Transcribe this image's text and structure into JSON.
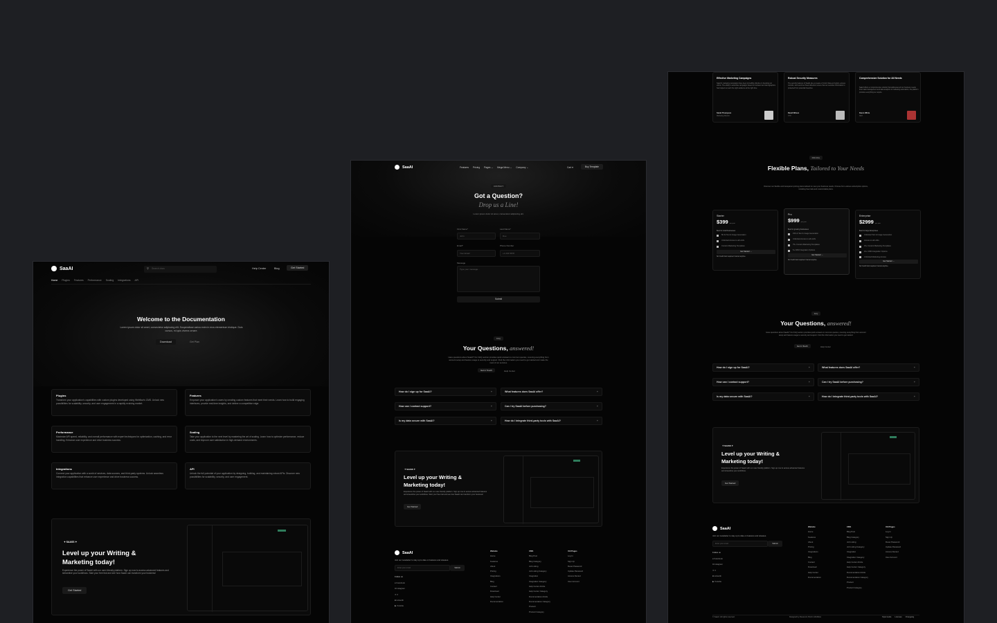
{
  "doc": {
    "brand": "SaaAI",
    "search_placeholder": "Search docs",
    "nav": {
      "help": "Help Center",
      "blog": "Blog",
      "cta": "Get Started"
    },
    "tabs": [
      "Home",
      "Plugins",
      "Features",
      "Performance",
      "Scaling",
      "Integrations",
      "API"
    ],
    "hero": {
      "title": "Welcome to the Documentation",
      "desc": "Lorem ipsum dolor sit amet, consectetur adipiscing elit. Suspendisse varius enim in eros elementum tristique. Duis cursus, mi quis viverra ornare.",
      "btn1": "Download",
      "btn2": "Get Plan"
    },
    "cards": [
      {
        "title": "Plugins",
        "desc": "Transform your application's capabilities with custom plugins developed using Webflow's CMS. Unlock new possibilities for scalability, security, and user engagement in a rapidly evolving market."
      },
      {
        "title": "Features",
        "desc": "Empower your application's users by creating custom features that meet their needs. Learn how to build engaging interfaces, provide real-time insights, and deliver a competitive edge."
      },
      {
        "title": "Performance",
        "desc": "Maximize API speed, reliability, and overall performance with expert techniques for optimization, caching, and error handling. Enhance user experience and drive business success."
      },
      {
        "title": "Scaling",
        "desc": "Take your application to the next level by mastering the art of scaling. Learn how to optimize performance, reduce costs, and improve user satisfaction in high-demand environments."
      },
      {
        "title": "Integrations",
        "desc": "Connect your application with a world of services, data sources, and third-party systems. Unlock seamless integration capabilities that enhance user experience and drive business success."
      },
      {
        "title": "API",
        "desc": "Unlock the full potential of your application by designing, building, and maintaining robust APIs. Discover new possibilities for scalability, security, and user engagement."
      }
    ],
    "cta": {
      "badge": "SAASS",
      "title1": "Level up your Writing &",
      "title2": "Marketing today!",
      "desc": "Experience the power of SaaAI with our user-friendly platform. Sign up now to access advanced features and streamline your workflows. Start your free trial and see how SaaAI can transform your business!",
      "btn": "Get Started"
    }
  },
  "contact": {
    "brand": "SaaAI",
    "nav": [
      "Features",
      "Pricing",
      "Pages",
      "Mega Menu",
      "Company"
    ],
    "cart": "Cart",
    "buy": "Buy Template",
    "badge": "CONTACT",
    "title": "Got a Question?",
    "subtitle": "Drop us a Line!",
    "desc": "Lorem ipsum dolor sit amet, consectetur adipiscing elit.",
    "form": {
      "first_label": "First Name*",
      "first_ph": "John",
      "last_label": "Last Name*",
      "last_ph": "Doe",
      "email_label": "Email*",
      "email_ph": "Your Email",
      "phone_label": "Phone Number",
      "phone_ph": "+1 234 5678",
      "msg_label": "Message",
      "msg_ph": "Type your message...",
      "submit": "Submit"
    },
    "faq_badge": "FAQ",
    "faq_title": "Your Questions,",
    "faq_title_em": "answered!",
    "faq_desc": "Have questions about SaaAI? Our FAQ section provides quick answers to common queries, covering everything from account setup and feature usage to security and support. Find the information you need to get started and make the most of our services.",
    "faq_btn1": "Get in Touch",
    "faq_btn2": "Help Center",
    "faqs": [
      "How do I sign up for SaaAI?",
      "What features does SaaAI offer?",
      "How can I contact support?",
      "Can I try SaaAI before purchasing?",
      "Is my data secure with SaaAI?",
      "How do I integrate third-party tools with SaaAI?"
    ],
    "cta": {
      "badge": "SAASS",
      "title1": "Level up your Writing &",
      "title2": "Marketing today!",
      "desc": "Experience the power of SaaAI with our user-friendly platform. Sign up now to access advanced features and streamline your workflows. Start your free trial and see how SaaAI can transform your business!",
      "btn": "Get Started"
    },
    "footer": {
      "newsletter": "Join our newsletter to stay up to date on features and releases.",
      "email_ph": "Enter your email",
      "subscribe": "Submit",
      "follow": "Follow us",
      "socials": [
        "Facebook",
        "Instagram",
        "X",
        "LinkedIn",
        "Youtube"
      ],
      "col1": {
        "head": "Website",
        "items": [
          "Home",
          "Features",
          "About",
          "Pricing",
          "Integrations",
          "Blog",
          "Contact",
          "Download",
          "Help Center",
          "Documentation"
        ]
      },
      "col2": {
        "head": "CMS",
        "items": [
          "Blog Post",
          "Blog Category",
          "Job Listing",
          "Job Listing Category",
          "Integration",
          "Integration Category",
          "Help Center Article",
          "Help Center Category",
          "Documentation Article",
          "Documentation Category",
          "Product",
          "Product Category"
        ]
      },
      "col3": {
        "head": "Util Pages",
        "items": [
          "Log In",
          "Sign Up",
          "Reset Password",
          "Update Password",
          "Access Denied",
          "User Account"
        ]
      }
    }
  },
  "pricing": {
    "testimonials": [
      {
        "title": "Effective Marketing Campaigns",
        "text": "SaaAI's marketing campaigns have been incredibly effective in boosting our efforts. The ability to automate campaigns based on behavior and demographics has helped us reach the right audience at the right time.",
        "name": "Sarah Thompson",
        "role": "Marketing Director"
      },
      {
        "title": "Robust Security Measures",
        "text": "The security features of SaaAI give us peace of mind. Data encryption, access controls, and real-time threat detection ensure that our sensitive information is protected from potential breaches.",
        "name": "David Wilson",
        "role": "CTO"
      },
      {
        "title": "Comprehensive Solution for All Needs",
        "text": "SaaAI offers a comprehensive solution that addresses all our business needs. From task management and data analytics to marketing automation, the platform provides everything we require.",
        "name": "Karen White",
        "role": "CEO"
      }
    ],
    "badge": "PRICING",
    "title": "Flexible Plans,",
    "title_em": "Tailored to Your Needs",
    "desc": "Discover our flexible and transparent pricing plans tailored to meet your business needs. Choose from various subscription options, including free trials and customizable plans.",
    "plans": [
      {
        "name": "Starter",
        "price": "$399",
        "per": "per year",
        "best": "Best for small businesses",
        "features": [
          "5K AI Text & Image Generation",
          "Unlimited Access to all LLMs",
          "Content Marketing Templates"
        ],
        "btn": "Get Started",
        "note": "No Credit Card required. Cancel anytime."
      },
      {
        "name": "Pro",
        "price": "$999",
        "per": "per year",
        "best": "Best for growing businesses",
        "features": [
          "15K AI Text & Image Generation",
          "Unlimited Access to all LLMs",
          "75+ Content Marketing Templates",
          "5+ CRM Integration Options"
        ],
        "btn": "Get Started",
        "note": "No Credit Card required. Cancel anytime."
      },
      {
        "name": "Enterprise",
        "price": "$2999",
        "per": "per year",
        "best": "Best for large Enterprises",
        "features": [
          "Unlimited Text & Image Generation",
          "Access to all LLMs",
          "15+ Content Marketing Templates",
          "10+ CRM Integration Options",
          "Unlimited Marketing Access"
        ],
        "btn": "Get Started",
        "note": "No Credit Card required. Cancel anytime."
      }
    ],
    "faq_badge": "FAQ",
    "faq_title": "Your Questions,",
    "faq_title_em": "answered!",
    "faq_desc": "Have questions about SaaAI? Our FAQ section provides quick answers to common queries, covering everything from account setup and feature usage to security and support. Find the information you need to get started.",
    "faq_btn1": "Get in Touch",
    "faq_btn2": "Help Center",
    "faqs": [
      "How do I sign up for SaaAI?",
      "What features does SaaAI offer?",
      "How can I contact support?",
      "Can I try SaaAI before purchasing?",
      "Is my data secure with SaaAI?",
      "How do I integrate third-party tools with SaaAI?"
    ],
    "cta": {
      "badge": "SAASS",
      "title1": "Level up your Writing &",
      "title2": "Marketing today!",
      "desc": "Experience the power of SaaAI with our user-friendly platform. Sign up now to access advanced features and streamline your workflows.",
      "btn": "Get Started"
    },
    "footer": {
      "brand": "SaaAI",
      "newsletter": "Join our newsletter to stay up to date on features and releases.",
      "email_ph": "Enter your email",
      "subscribe": "Submit",
      "follow": "Follow us",
      "socials": [
        "Facebook",
        "Instagram",
        "X",
        "LinkedIn",
        "Youtube"
      ],
      "col1": {
        "head": "Website",
        "items": [
          "Home",
          "Features",
          "About",
          "Pricing",
          "Integrations",
          "Blog",
          "Contact",
          "Download",
          "Help Center",
          "Documentation"
        ]
      },
      "col2": {
        "head": "CMS",
        "items": [
          "Blog Post",
          "Blog Category",
          "Job Listing",
          "Job Listing Category",
          "Integration",
          "Integration Category",
          "Help Center Article",
          "Help Center Category",
          "Documentation Article",
          "Documentation Category",
          "Product",
          "Product Category"
        ]
      },
      "col3": {
        "head": "Util Pages",
        "items": [
          "Log In",
          "Sign Up",
          "Reset Password",
          "Update Password",
          "Access Denied",
          "User Account"
        ]
      },
      "copyright": "© SaaAI. All rights reserved.",
      "designed": "Designed by Reservoir, Built in Webflow",
      "links": [
        "Style Guide",
        "Licenses",
        "Changelog"
      ]
    }
  }
}
